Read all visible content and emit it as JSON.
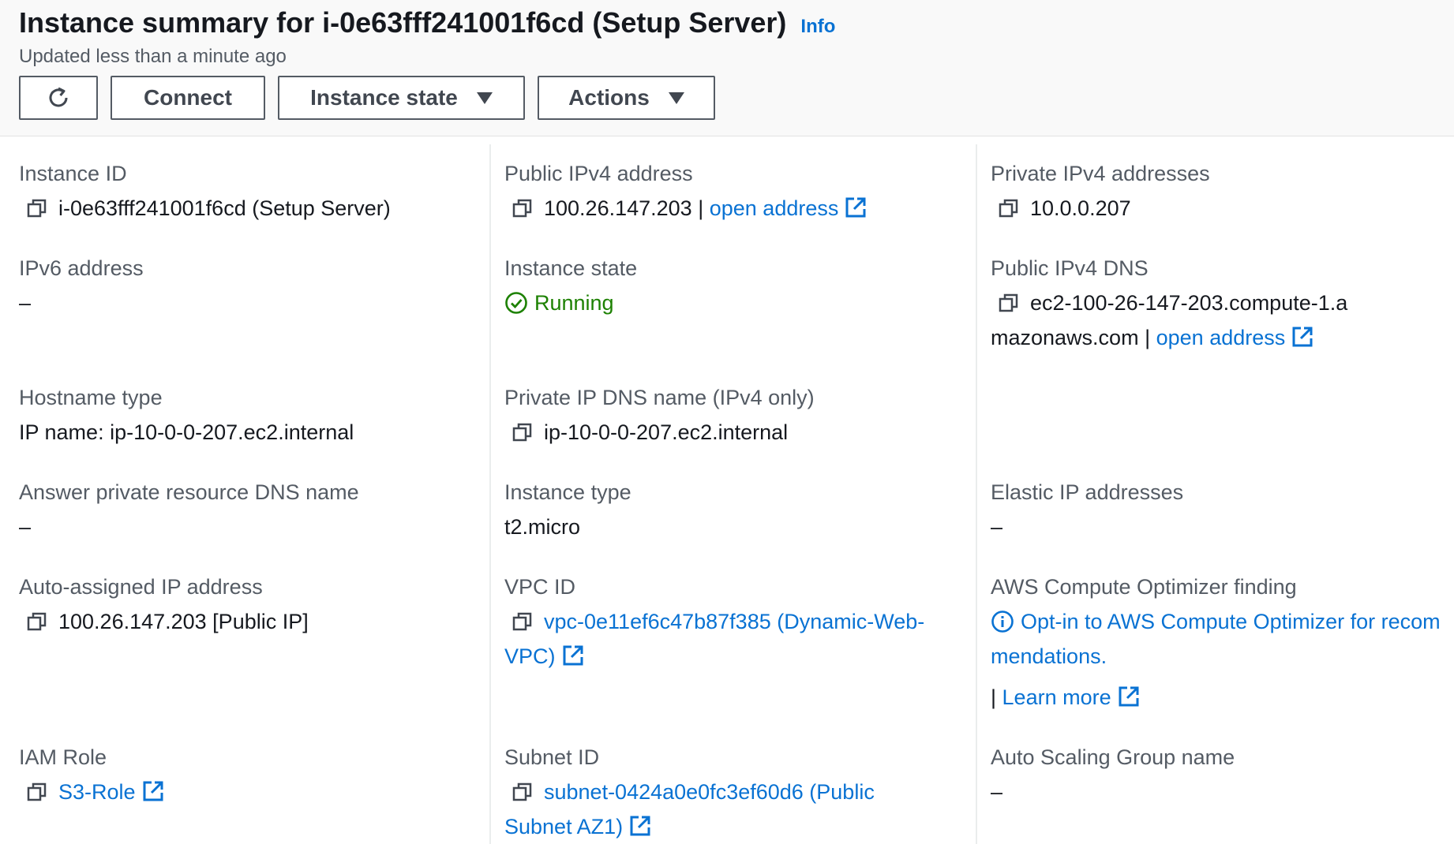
{
  "header": {
    "title": "Instance summary for i-0e63fff241001f6cd (Setup Server)",
    "info": "Info",
    "subtitle": "Updated less than a minute ago",
    "buttons": {
      "connect": "Connect",
      "instance_state": "Instance state",
      "actions": "Actions"
    }
  },
  "fields": {
    "instance_id": {
      "label": "Instance ID",
      "value": "i-0e63fff241001f6cd (Setup Server)"
    },
    "public_ipv4": {
      "label": "Public IPv4 address",
      "value": "100.26.147.203",
      "sep": "|",
      "link": "open address"
    },
    "private_ipv4": {
      "label": "Private IPv4 addresses",
      "value": "10.0.0.207"
    },
    "ipv6": {
      "label": "IPv6 address",
      "value": "–"
    },
    "instance_state": {
      "label": "Instance state",
      "value": "Running"
    },
    "public_dns": {
      "label": "Public IPv4 DNS",
      "value": "ec2-100-26-147-203.compute-1.amazonaws.com",
      "sep": "|",
      "link": "open address"
    },
    "hostname_type": {
      "label": "Hostname type",
      "value": "IP name: ip-10-0-0-207.ec2.internal"
    },
    "private_dns": {
      "label": "Private IP DNS name (IPv4 only)",
      "value": "ip-10-0-0-207.ec2.internal"
    },
    "answer_dns": {
      "label": "Answer private resource DNS name",
      "value": "–"
    },
    "instance_type": {
      "label": "Instance type",
      "value": "t2.micro"
    },
    "elastic_ip": {
      "label": "Elastic IP addresses",
      "value": "–"
    },
    "auto_ip": {
      "label": "Auto-assigned IP address",
      "value": "100.26.147.203 [Public IP]"
    },
    "vpc_id": {
      "label": "VPC ID",
      "value": "vpc-0e11ef6c47b87f385 (Dynamic-Web-VPC)"
    },
    "optimizer": {
      "label": "AWS Compute Optimizer finding",
      "value": "Opt-in to AWS Compute Optimizer for recommendations.",
      "sep": "|",
      "link": "Learn more"
    },
    "iam_role": {
      "label": "IAM Role",
      "value": "S3-Role"
    },
    "subnet_id": {
      "label": "Subnet ID",
      "value": "subnet-0424a0e0fc3ef60d6 (Public Subnet AZ1)"
    },
    "asg_name": {
      "label": "Auto Scaling Group name",
      "value": "–"
    }
  },
  "colors": {
    "link": "#0972d3",
    "running": "#1d8102",
    "label": "#545b64",
    "text": "#16191f"
  },
  "icons": [
    "refresh-icon",
    "copy-icon",
    "external-link-icon",
    "check-circle-icon",
    "info-circle-icon",
    "caret-down-icon"
  ]
}
